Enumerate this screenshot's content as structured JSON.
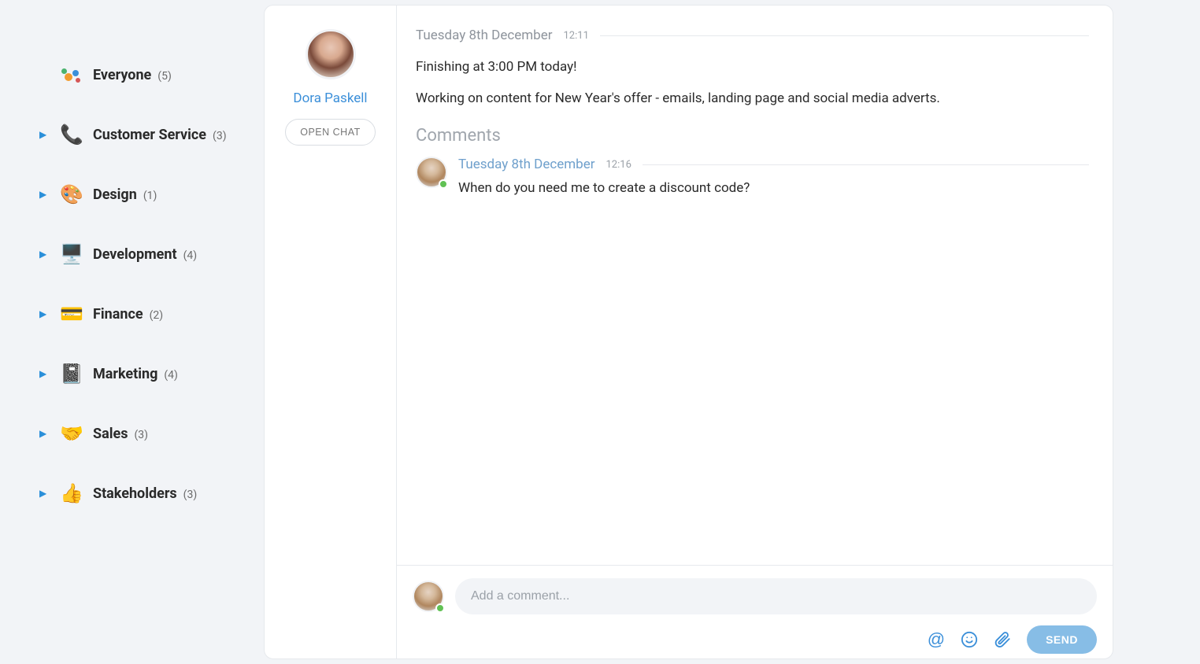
{
  "sidebar": {
    "teams": [
      {
        "label": "Everyone",
        "count": "(5)",
        "emoji": "",
        "kind": "everyone"
      },
      {
        "label": "Customer Service",
        "count": "(3)",
        "emoji": "📞"
      },
      {
        "label": "Design",
        "count": "(1)",
        "emoji": "🎨"
      },
      {
        "label": "Development",
        "count": "(4)",
        "emoji": "🖥️"
      },
      {
        "label": "Finance",
        "count": "(2)",
        "emoji": "💳"
      },
      {
        "label": "Marketing",
        "count": "(4)",
        "emoji": "📓"
      },
      {
        "label": "Sales",
        "count": "(3)",
        "emoji": "🤝"
      },
      {
        "label": "Stakeholders",
        "count": "(3)",
        "emoji": "👍"
      }
    ]
  },
  "profile": {
    "name": "Dora Paskell",
    "open_chat": "OPEN CHAT"
  },
  "post": {
    "date": "Tuesday 8th December",
    "time": "12:11",
    "lines": [
      "Finishing at 3:00 PM today!",
      "Working on content for New Year's offer - emails, landing page and social media adverts."
    ]
  },
  "comments": {
    "heading": "Comments",
    "items": [
      {
        "date": "Tuesday 8th December",
        "time": "12:16",
        "text": "When do you need me to create a discount code?"
      }
    ]
  },
  "composer": {
    "placeholder": "Add a comment...",
    "send_label": "SEND",
    "mention_glyph": "@"
  }
}
